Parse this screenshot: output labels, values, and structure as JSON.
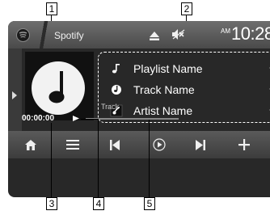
{
  "statusbar": {
    "app_title": "Spotify",
    "clock_ampm": "AM",
    "clock_time": "10:28",
    "icons": [
      "spotify-icon",
      "eject-icon",
      "mute-icon"
    ]
  },
  "now_playing": {
    "playlist_name": "Playlist Name",
    "track_name": "Track Name",
    "artist_name": "Artist Name",
    "elapsed_time": "00:00:00",
    "track_label": "Track",
    "progress": 0.0
  },
  "callouts": {
    "c1": "1",
    "c2": "2",
    "c3": "3",
    "c4": "4",
    "c5": "5"
  },
  "controls": {
    "icons": [
      "home-icon",
      "menu-icon",
      "previous-icon",
      "play-pause-icon",
      "next-icon",
      "plus-icon"
    ]
  },
  "colors": {
    "screen_bg": "#282828",
    "bar_gray": "#4a4a4a",
    "text": "#ffffff"
  }
}
